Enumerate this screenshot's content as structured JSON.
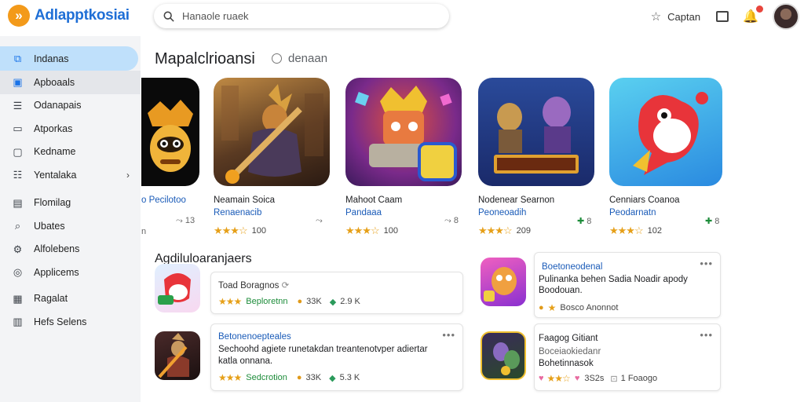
{
  "app": {
    "logo_glyph": "»",
    "name": "Adlapptkosiai"
  },
  "search": {
    "value": "Hanaole ruaek",
    "placeholder": ""
  },
  "header": {
    "star_label": "Captan"
  },
  "sidebar": {
    "items": [
      {
        "label": "Indanas",
        "icon": "apps-icon"
      },
      {
        "label": "Apboaals",
        "icon": "chart-icon"
      },
      {
        "label": "Odanapais",
        "icon": "list-icon"
      },
      {
        "label": "Atporkas",
        "icon": "doc-icon"
      },
      {
        "label": "Kedname",
        "icon": "card-icon"
      },
      {
        "label": "Yentalaka",
        "icon": "menu-icon"
      },
      {
        "label": "Flomilag",
        "icon": "note-icon"
      },
      {
        "label": "Ubates",
        "icon": "tag-icon"
      },
      {
        "label": "Alfolebens",
        "icon": "gear-icon"
      },
      {
        "label": "Applicems",
        "icon": "globe-icon"
      },
      {
        "label": "Ragalat",
        "icon": "table-icon"
      },
      {
        "label": "Hefs Selens",
        "icon": "grid-icon"
      }
    ]
  },
  "featured": {
    "title": "Mapalclrioansi",
    "subtitle": "denaan",
    "cards": [
      {
        "line1": "o Pecilotoo",
        "line2": "",
        "rating": "",
        "meta": "13",
        "left_meta": "n"
      },
      {
        "line1": "Neamain Soica",
        "line2": "Renaenacib",
        "rating": "100",
        "meta": ""
      },
      {
        "line1": "Mahoot Caam",
        "line2": "Pandaaa",
        "rating": "100",
        "meta": "8"
      },
      {
        "line1": "Nodenear Searnon",
        "line2": "Peoneoadih",
        "rating": "209",
        "meta": "8"
      },
      {
        "line1": "Cenniars Coanoa",
        "line2": "Peodarnatn",
        "rating": "102",
        "meta": "8"
      }
    ]
  },
  "list": {
    "title": "Agdiluloaranjaers",
    "rows": [
      {
        "line1": "Toad Boragnos",
        "line2": "",
        "green_label": "Beploretnn",
        "count1": "33K",
        "count2": "2.9 K"
      },
      {
        "line1": "Boetoneodenal",
        "line2": "Pulinanka behen Sadia Noadir apody",
        "line3": "Boodouan.",
        "meta": "Bosco Anonnot"
      },
      {
        "line1": "Betonenoepteales",
        "line2": "Sechoohd agiete runetakdan treantenotvper adiertar",
        "line3": "katla onnana.",
        "green_label": "Sedcrotion",
        "count1": "33K",
        "count2": "5.3 K"
      },
      {
        "line1": "Faagog Gitiant",
        "line2": "Boceiaokiedanr",
        "line3": "Bohetinnasok",
        "counts": "3S2s",
        "extra": "1 Foaogo"
      }
    ]
  },
  "colors": {
    "brand": "#f39a1a",
    "link": "#1a5bb8",
    "active": "#bfe0fb",
    "star": "#e6a019"
  }
}
